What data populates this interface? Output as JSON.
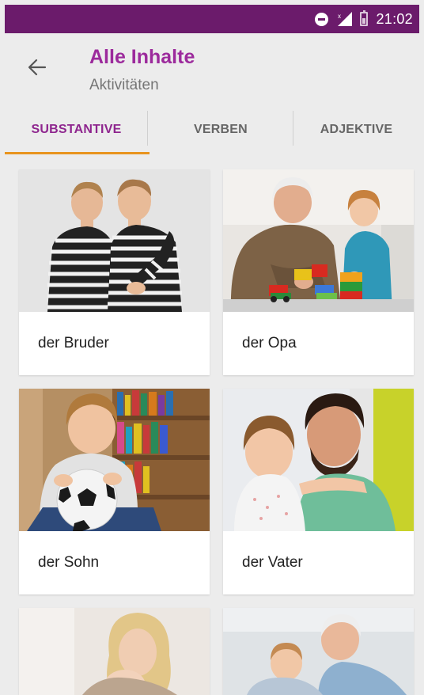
{
  "status_bar": {
    "time": "21:02",
    "icons": [
      "do-not-disturb-icon",
      "signal-icon",
      "battery-icon"
    ]
  },
  "header": {
    "title": "Alle Inhalte",
    "subtitle": "Aktivitäten",
    "back_icon": "arrow-left-icon"
  },
  "tabs": [
    {
      "label": "SUBSTANTIVE",
      "active": true
    },
    {
      "label": "VERBEN",
      "active": false
    },
    {
      "label": "ADJEKTIVE",
      "active": false
    }
  ],
  "cards": [
    {
      "label": "der Bruder",
      "image": "two-brothers-photo"
    },
    {
      "label": "der Opa",
      "image": "grandfather-with-child-photo"
    },
    {
      "label": "der Sohn",
      "image": "boy-with-football-photo"
    },
    {
      "label": "der Vater",
      "image": "father-hugging-daughter-photo"
    },
    {
      "label": "",
      "image": "mother-with-baby-photo"
    },
    {
      "label": "",
      "image": "grandmother-with-child-photo"
    }
  ],
  "colors": {
    "status_bar": "#6b1b6b",
    "title": "#9c2a9c",
    "active_tab": "#8e258e",
    "tab_indicator": "#e8941e",
    "background": "#ececec"
  }
}
